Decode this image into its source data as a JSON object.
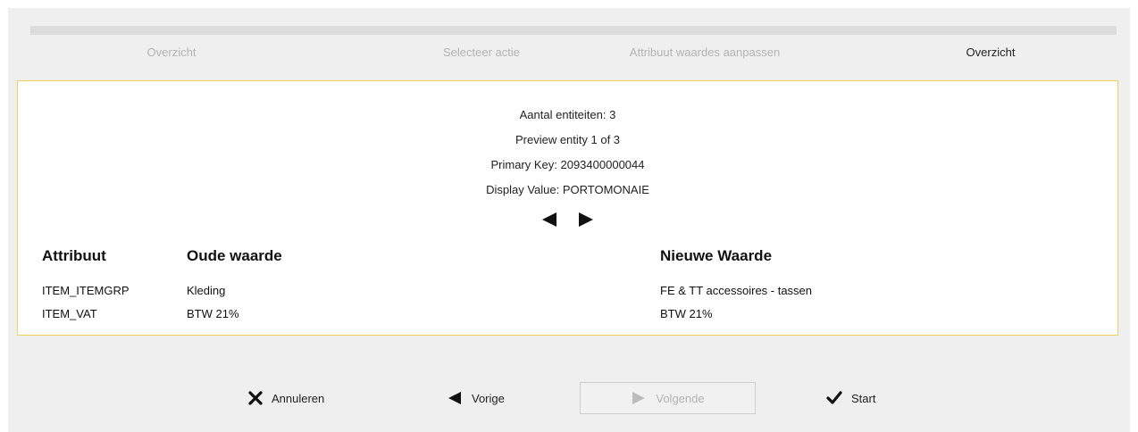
{
  "wizard": {
    "steps": [
      {
        "label": "Overzicht",
        "active": false
      },
      {
        "label": "Selecteer actie",
        "active": false
      },
      {
        "label": "Attribuut waardes aanpassen",
        "active": false
      },
      {
        "label": "Overzicht",
        "active": true
      }
    ]
  },
  "summary": {
    "entity_count": "Aantal entiteiten:  3",
    "preview": "Preview entity 1 of 3",
    "primary_key": "Primary Key:  2093400000044",
    "display_value": "Display Value:  PORTOMONAIE",
    "prev_icon": "triangle-left-icon",
    "next_icon": "triangle-right-icon"
  },
  "table": {
    "headers": {
      "attribute": "Attribuut",
      "old_value": "Oude waarde",
      "new_value": "Nieuwe Waarde"
    },
    "rows": [
      {
        "attribute": "ITEM_ITEMGRP",
        "old": "Kleding",
        "new": "FE & TT accessoires - tassen"
      },
      {
        "attribute": "ITEM_VAT",
        "old": "BTW 21%",
        "new": "BTW 21%"
      }
    ]
  },
  "footer": {
    "cancel_label": "Annuleren",
    "prev_label": "Vorige",
    "next_label": "Volgende",
    "start_label": "Start",
    "next_disabled": true
  },
  "colors": {
    "panel_border": "#f2cf57",
    "background": "#efefef",
    "inactive_step": "#b3b3b3"
  }
}
